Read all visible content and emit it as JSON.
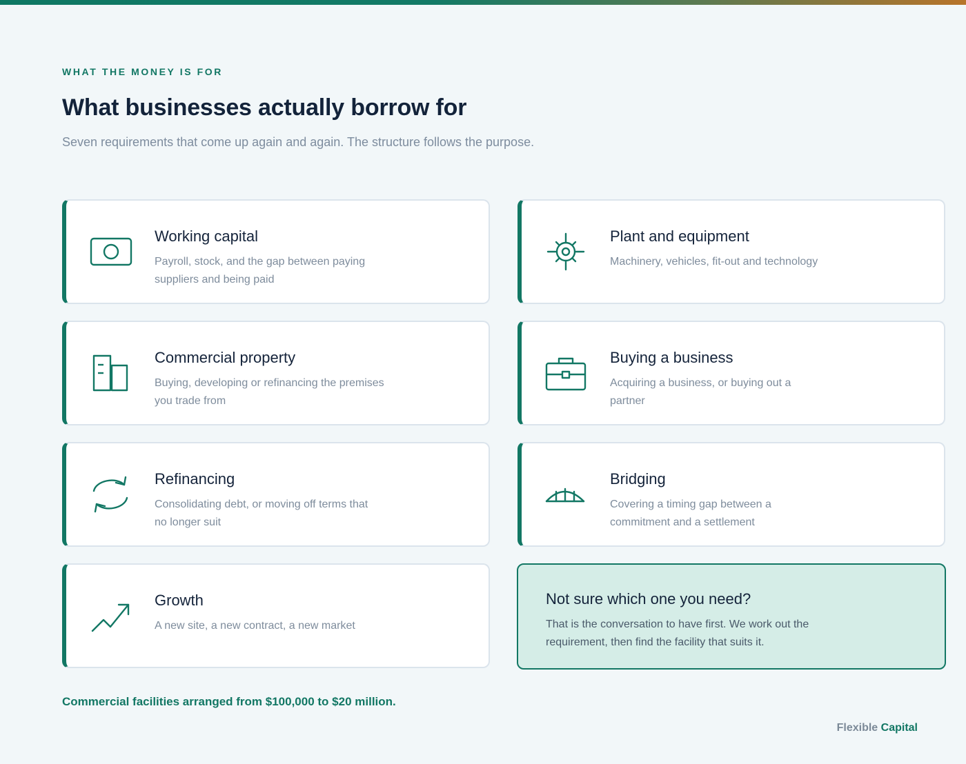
{
  "section": {
    "eyebrow": "WHAT THE MONEY IS FOR",
    "headline": "What businesses actually borrow for",
    "subhead": "Seven requirements that come up again and again. The structure follows the purpose."
  },
  "colors": {
    "accent": "#127764",
    "cta_background": "#d5ede7",
    "page_background": "#f2f7f9"
  },
  "cards": [
    {
      "icon": "banknote-icon",
      "title": "Working capital",
      "description": "Payroll, stock, and the gap between paying suppliers and being paid"
    },
    {
      "icon": "gear-icon",
      "title": "Plant and equipment",
      "description": "Machinery, vehicles, fit-out and technology"
    },
    {
      "icon": "building-icon",
      "title": "Commercial property",
      "description": "Buying, developing or refinancing the premises you trade from"
    },
    {
      "icon": "briefcase-icon",
      "title": "Buying a business",
      "description": "Acquiring a business, or buying out a partner"
    },
    {
      "icon": "refresh-icon",
      "title": "Refinancing",
      "description": "Consolidating debt, or moving off terms that no longer suit"
    },
    {
      "icon": "bridge-icon",
      "title": "Bridging",
      "description": "Covering a timing gap between a commitment and a settlement"
    },
    {
      "icon": "trend-up-icon",
      "title": "Growth",
      "description": "A new site, a new contract, a new market"
    }
  ],
  "cta": {
    "title": "Not sure which one you need?",
    "description": "That is the conversation to have first. We work out the requirement, then find the facility that suits it."
  },
  "footer": {
    "range_note": "Commercial facilities arranged from $100,000 to $20 million.",
    "brand_part1": "Flexible",
    "brand_part2": "Capital"
  }
}
